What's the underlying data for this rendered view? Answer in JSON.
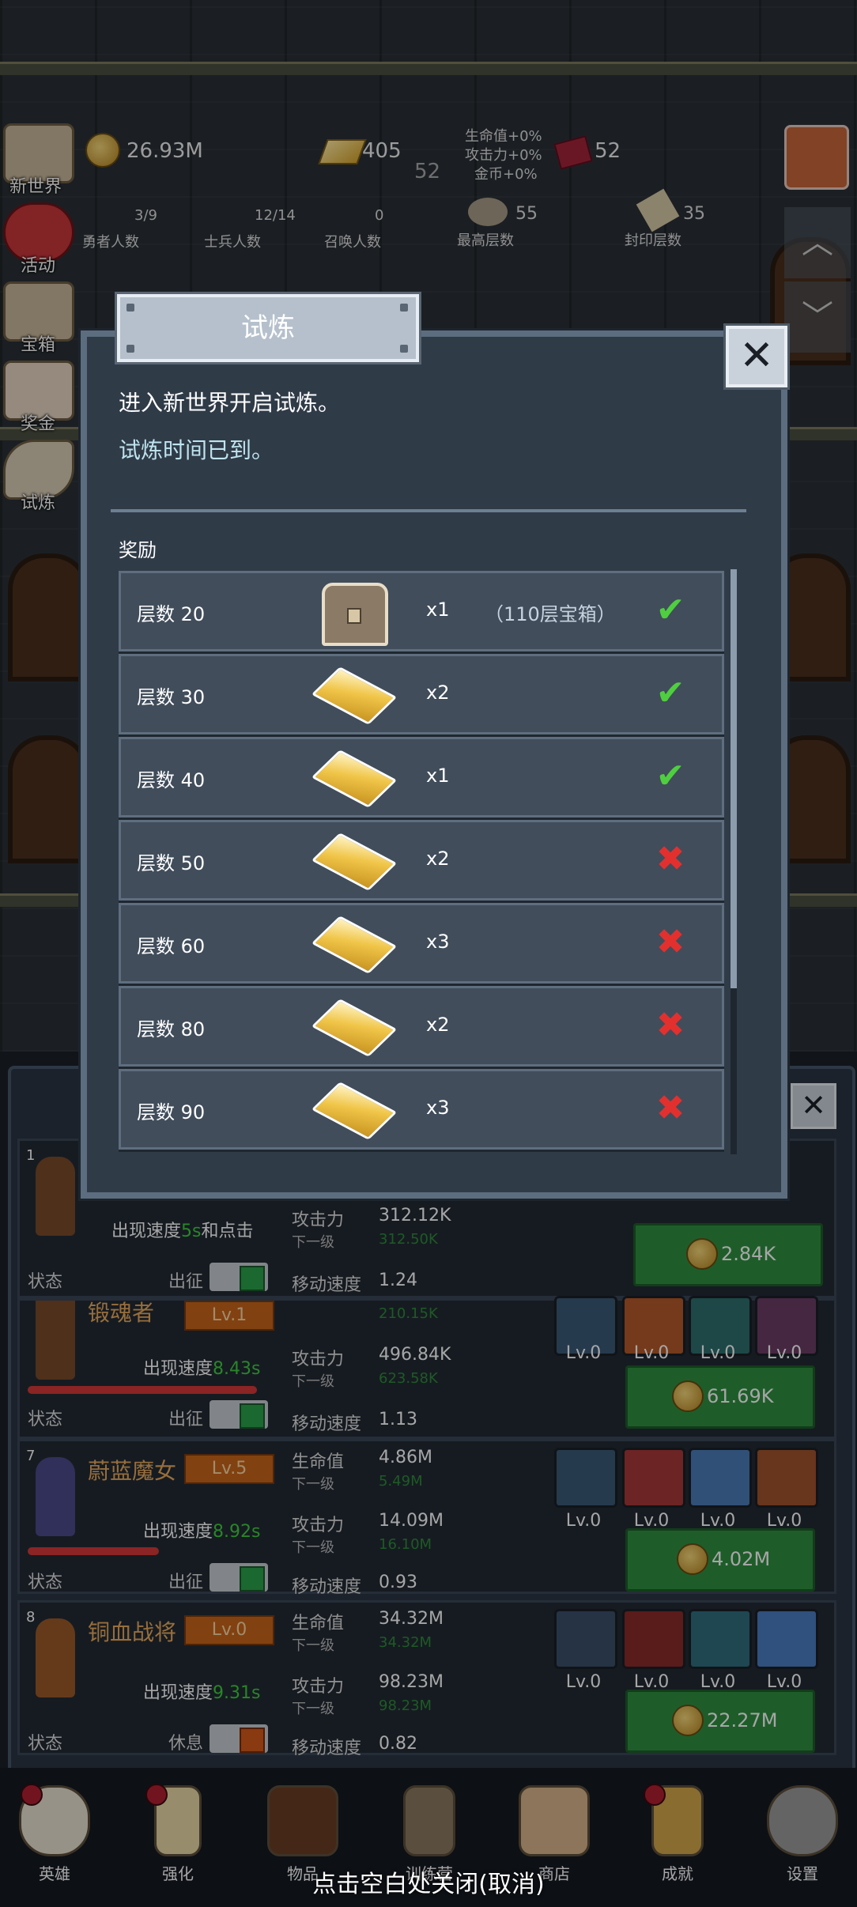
{
  "top_stats": {
    "coins": "26.93M",
    "gold": "405",
    "gold_sub": "52",
    "gems": "52",
    "bonus_hp": "生命值+0%",
    "bonus_atk": "攻击力+0%",
    "bonus_coin": "金币+0%",
    "braves": "3/9",
    "braves_label": "勇者人数",
    "soldiers": "12/14",
    "soldiers_label": "士兵人数",
    "summons": "0",
    "summons_label": "召唤人数",
    "max_floor": "55",
    "max_floor_label": "最高层数",
    "seal_floor": "35",
    "seal_floor_label": "封印层数"
  },
  "side_menu": [
    {
      "label": "新世界",
      "icon": "map-icon"
    },
    {
      "label": "活动",
      "icon": "heart-icon"
    },
    {
      "label": "宝箱",
      "icon": "chest-icon"
    },
    {
      "label": "奖金",
      "icon": "envelope-icon"
    },
    {
      "label": "试炼",
      "icon": "feather-icon"
    }
  ],
  "heroes": [
    {
      "index": "1",
      "speed_prefix": "出现速度",
      "speed": "5s",
      "speed_suffix": "和点击",
      "atk_label": "攻击力",
      "atk": "312.12K",
      "next_label": "下一级",
      "atk_next": "312.50K",
      "move_label": "移动速度",
      "move": "1.24",
      "state_label": "状态",
      "state": "出征",
      "upgrade_cost": "2.84K"
    },
    {
      "name": "锻魂者",
      "level": "Lv.1",
      "speed_prefix": "出现速度",
      "speed": "8.43s",
      "hp_next_partial": "210.15K",
      "atk_label": "攻击力",
      "atk": "496.84K",
      "next_label": "下一级",
      "atk_next": "623.58K",
      "move_label": "移动速度",
      "move": "1.13",
      "state_label": "状态",
      "state": "出征",
      "upgrade_cost": "61.69K",
      "skills": [
        "Lv.0",
        "Lv.0",
        "Lv.0",
        "Lv.0"
      ]
    },
    {
      "index": "7",
      "name": "蔚蓝魔女",
      "level": "Lv.5",
      "speed_prefix": "出现速度",
      "speed": "8.92s",
      "hp_label": "生命值",
      "hp": "4.86M",
      "next_label": "下一级",
      "hp_next": "5.49M",
      "atk_label": "攻击力",
      "atk": "14.09M",
      "atk_next": "16.10M",
      "move_label": "移动速度",
      "move": "0.93",
      "state_label": "状态",
      "state": "出征",
      "upgrade_cost": "4.02M",
      "skills": [
        "Lv.0",
        "Lv.0",
        "Lv.0",
        "Lv.0"
      ]
    },
    {
      "index": "8",
      "name": "铜血战将",
      "level": "Lv.0",
      "speed_prefix": "出现速度",
      "speed": "9.31s",
      "hp_label": "生命值",
      "hp": "34.32M",
      "next_label": "下一级",
      "hp_next": "34.32M",
      "atk_label": "攻击力",
      "atk": "98.23M",
      "atk_next": "98.23M",
      "move_label": "移动速度",
      "move": "0.82",
      "state_label": "状态",
      "state": "休息",
      "upgrade_cost": "22.27M",
      "skills": [
        "Lv.0",
        "Lv.0",
        "Lv.0",
        "Lv.0"
      ]
    }
  ],
  "nav": [
    {
      "label": "英雄",
      "icon": "skull-icon"
    },
    {
      "label": "强化",
      "icon": "candle-icon"
    },
    {
      "label": "物品",
      "icon": "book-icon"
    },
    {
      "label": "训练营",
      "icon": "lantern-icon"
    },
    {
      "label": "商店",
      "icon": "mug-icon"
    },
    {
      "label": "成就",
      "icon": "key-icon"
    },
    {
      "label": "设置",
      "icon": "gear-icon"
    }
  ],
  "dialog": {
    "title": "试炼",
    "message": "进入新世界开启试炼。",
    "status": "试炼时间已到。",
    "rewards_label": "奖励",
    "rewards": [
      {
        "floor": "层数 20",
        "item": "chest",
        "qty": "x1",
        "note": "（110层宝箱）",
        "done": true
      },
      {
        "floor": "层数 30",
        "item": "gold-bar",
        "qty": "x2",
        "note": "",
        "done": true
      },
      {
        "floor": "层数 40",
        "item": "gold-bar",
        "qty": "x1",
        "note": "",
        "done": true
      },
      {
        "floor": "层数 50",
        "item": "gold-bar",
        "qty": "x2",
        "note": "",
        "done": false
      },
      {
        "floor": "层数 60",
        "item": "gold-bar",
        "qty": "x3",
        "note": "",
        "done": false
      },
      {
        "floor": "层数 80",
        "item": "gold-bar",
        "qty": "x2",
        "note": "",
        "done": false
      },
      {
        "floor": "层数 90",
        "item": "gold-bar",
        "qty": "x3",
        "note": "",
        "done": false
      }
    ]
  },
  "close_hint": "点击空白处关闭(取消)",
  "colors": {
    "accent_green": "#2f8f3f",
    "level_orange": "#c8651a",
    "check_green": "#4fcf3f",
    "cross_red": "#e2302f"
  }
}
